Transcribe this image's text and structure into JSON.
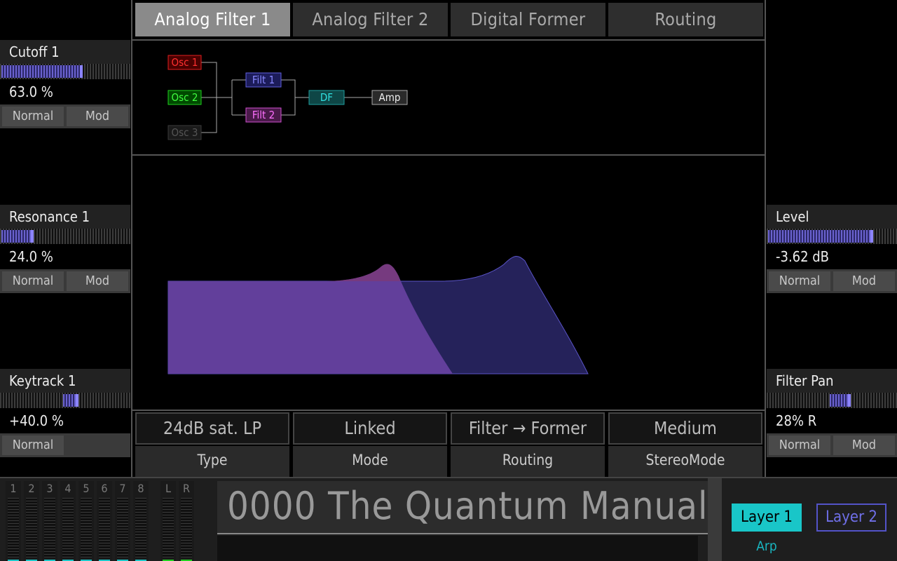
{
  "tabs": [
    "Analog Filter 1",
    "Analog Filter 2",
    "Digital Former",
    "Routing"
  ],
  "left_params": [
    {
      "title": "Cutoff 1",
      "value": "63.0 %",
      "level": 0.63,
      "buttons": [
        "Normal",
        "Mod"
      ]
    },
    {
      "title": "Resonance 1",
      "value": "24.0 %",
      "level": 0.24,
      "buttons": [
        "Normal",
        "Mod"
      ]
    },
    {
      "title": "Keytrack 1",
      "value": "+40.0 %",
      "bipolar": 0.4,
      "buttons": [
        "Normal"
      ]
    }
  ],
  "right_params": [
    {
      "title": "Level",
      "value": "-3.62 dB",
      "level": 0.8,
      "buttons": [
        "Normal",
        "Mod"
      ]
    },
    {
      "title": "Filter Pan",
      "value": "28% R",
      "bipolar": 0.28,
      "buttons": [
        "Normal",
        "Mod"
      ]
    }
  ],
  "routing": {
    "osc1": "Osc 1",
    "osc2": "Osc 2",
    "osc3": "Osc 3",
    "filt1": "Filt 1",
    "filt2": "Filt 2",
    "df": "DF",
    "amp": "Amp",
    "colors": {
      "osc1": "#e02020",
      "osc2": "#20d020",
      "osc3": "#555555",
      "filt1": "#7070ff",
      "filt2": "#e060e0",
      "df": "#20c0c0",
      "amp": "#dddddd"
    }
  },
  "bottom_params": [
    {
      "value": "24dB sat. LP",
      "label": "Type"
    },
    {
      "value": "Linked",
      "label": "Mode"
    },
    {
      "value": "Filter → Former",
      "label": "Routing"
    },
    {
      "value": "Medium",
      "label": "StereoMode"
    }
  ],
  "channels": [
    "1",
    "2",
    "3",
    "4",
    "5",
    "6",
    "7",
    "8",
    "L",
    "R"
  ],
  "patch_name": "0000 The Quantum Manual",
  "layers": {
    "layer1": "Layer 1",
    "layer2": "Layer 2",
    "arp": "Arp"
  },
  "colors": {
    "accent": "#19c6c8",
    "meter": "#6a62cf",
    "filter1_fill": "#623f9b",
    "filter2_fill": "#25225a"
  }
}
